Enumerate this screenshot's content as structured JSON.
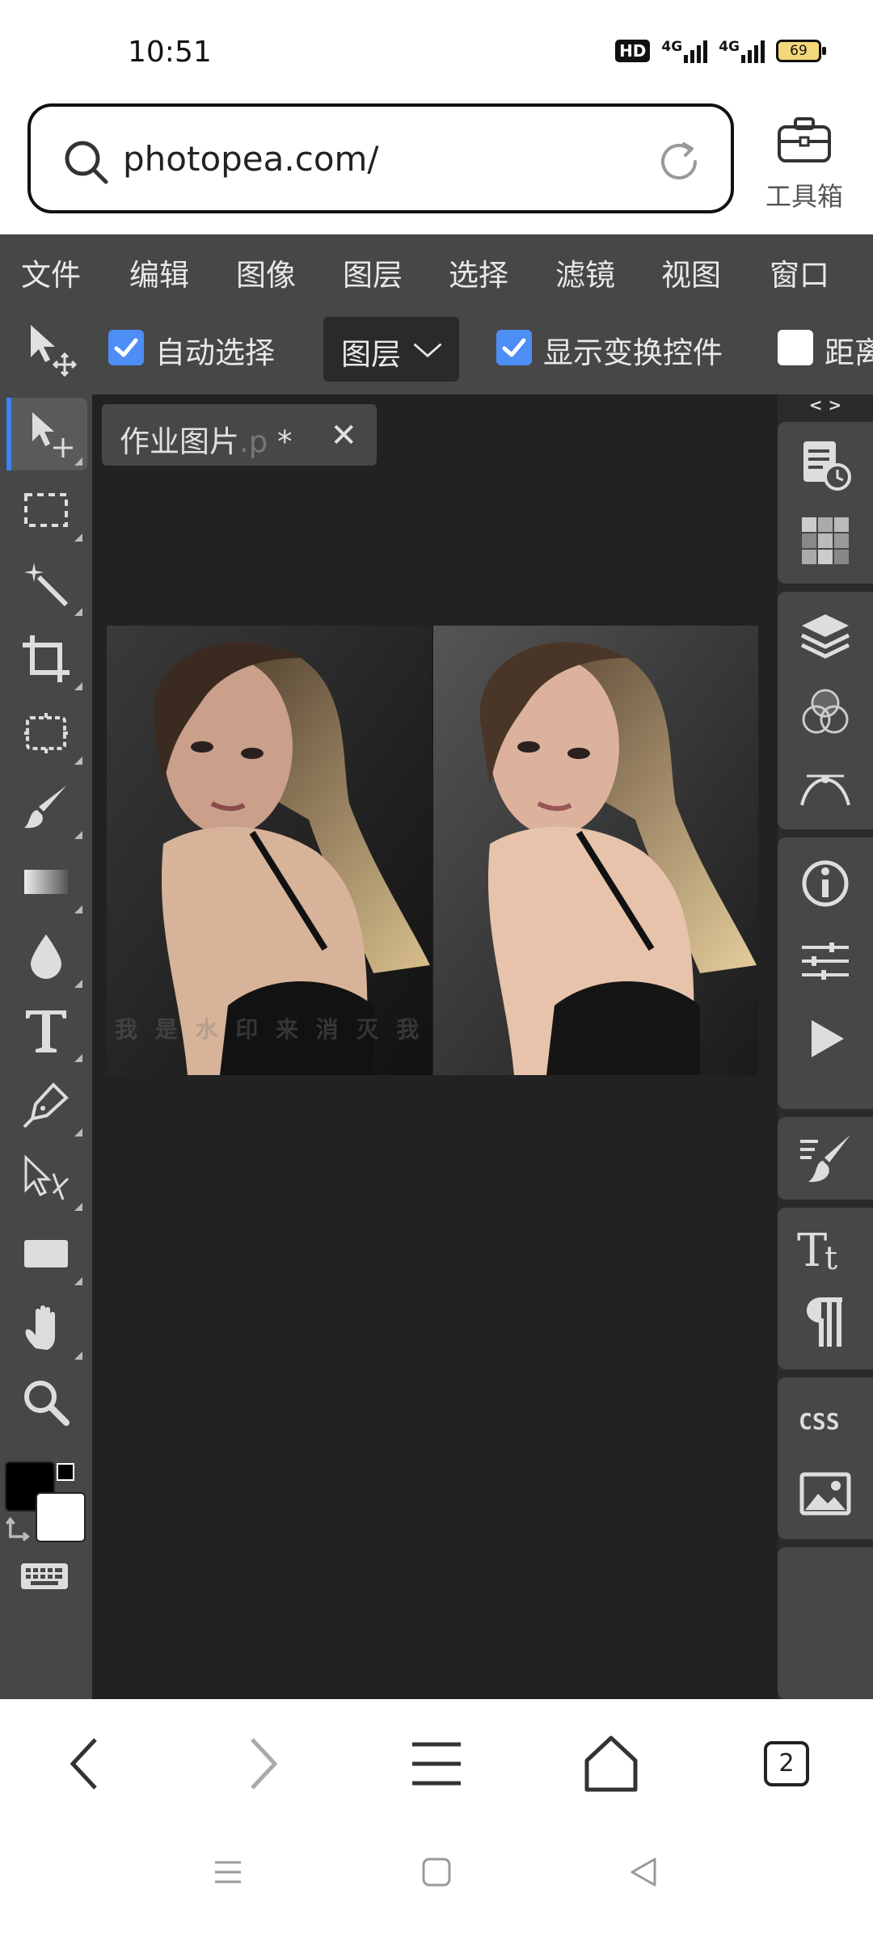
{
  "status_bar": {
    "time": "10:51",
    "hd_badge": "HD",
    "signal1_label": "4G",
    "signal2_label": "4G",
    "battery": "69"
  },
  "browser": {
    "url": "photopea.com/",
    "toolbox_label": "工具箱",
    "tab_count": "2"
  },
  "menu": {
    "items": [
      "文件",
      "编辑",
      "图像",
      "图层",
      "选择",
      "滤镜",
      "视图",
      "窗口"
    ]
  },
  "options": {
    "auto_select_label": "自动选择",
    "auto_select_checked": true,
    "layer_dropdown_value": "图层",
    "show_transform_label": "显示变换控件",
    "show_transform_checked": true,
    "distance_label": "距离"
  },
  "document": {
    "tab_name": "作业图片",
    "tab_ext": ".p",
    "tab_modified": "*",
    "close_symbol": "✕"
  },
  "right_panel": {
    "toggle": "< >"
  },
  "colors": {
    "app_bg": "#474747",
    "canvas_bg": "#222222",
    "panel_gap": "#2b2b2b",
    "accent": "#3b82f6",
    "checkbox": "#4d8ef5",
    "foreground_color": "#000000",
    "background_color": "#ffffff"
  },
  "tools": [
    "move-tool",
    "marquee-tool",
    "magic-wand-tool",
    "crop-tool",
    "frame-tool",
    "brush-tool",
    "gradient-tool",
    "blur-tool",
    "type-tool",
    "pen-tool",
    "path-select-tool",
    "rectangle-tool",
    "hand-tool",
    "zoom-tool"
  ],
  "right_icons": [
    "history-icon",
    "swatches-icon",
    "layers-icon",
    "channels-icon",
    "paths-icon",
    "info-icon",
    "adjustments-icon",
    "actions-icon",
    "brush-settings-icon",
    "character-icon",
    "paragraph-icon",
    "css-icon",
    "image-icon"
  ]
}
